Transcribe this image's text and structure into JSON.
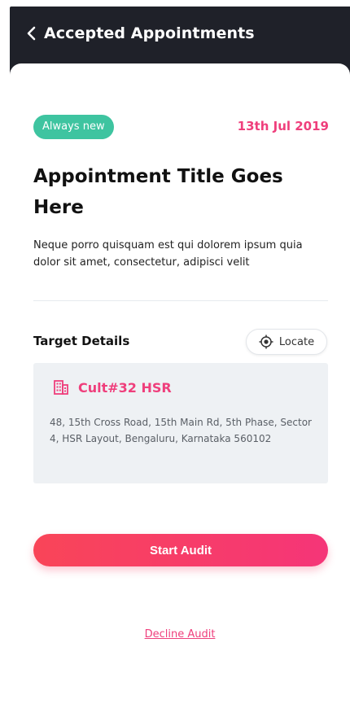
{
  "header": {
    "title": "Accepted Appointments",
    "back_icon": "chevron-left-icon",
    "background": "#1f2129"
  },
  "appointment": {
    "badge": "Always new",
    "badge_color": "#3ec4a0",
    "date": "13th Jul 2019",
    "title": "Appointment Title Goes Here",
    "description": "Neque porro quisquam est qui dolorem ipsum quia dolor sit amet, consectetur, adipisci velit"
  },
  "target": {
    "label": "Target Details",
    "locate_label": "Locate",
    "locate_icon": "target-icon",
    "venue_icon": "building-icon",
    "venue_name": "Cult#32 HSR",
    "address": "48, 15th Cross Road, 15th Main Rd, 5th Phase, Sector 4, HSR Layout, Bengaluru, Karnataka 560102"
  },
  "actions": {
    "start_label": "Start Audit",
    "decline_label": "Decline Audit",
    "accent": "#ef3f7c"
  }
}
